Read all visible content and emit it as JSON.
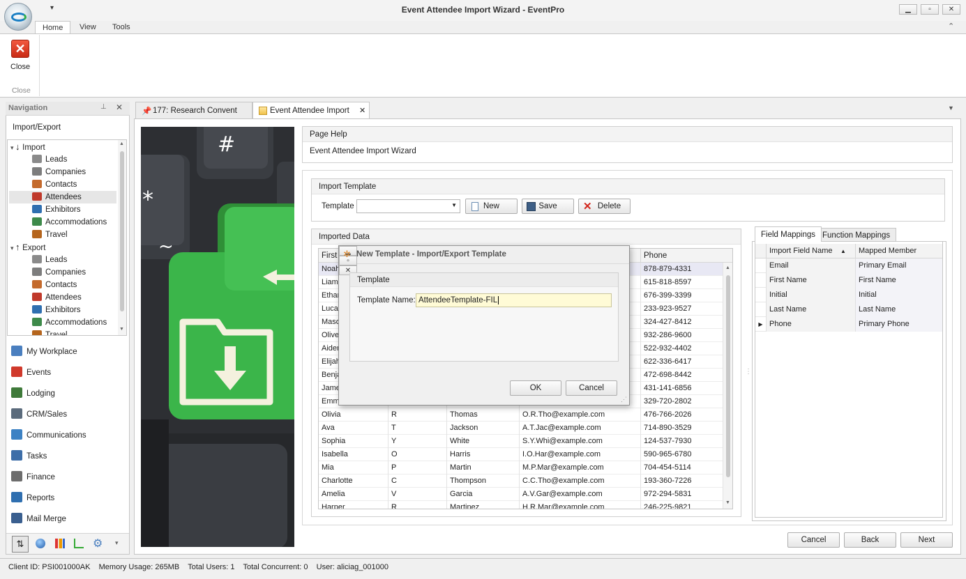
{
  "app": {
    "title": "Event Attendee Import Wizard - EventPro",
    "qat_arrow": "▾"
  },
  "window_buttons": {
    "minimize": "▁",
    "restore": "▫",
    "close": "✕"
  },
  "ribbon": {
    "tabs": [
      "Home",
      "View",
      "Tools"
    ],
    "active_tab": "Home",
    "close_button_label": "Close",
    "group_label": "Close",
    "collapse_glyph": "⌃"
  },
  "navigation": {
    "header": "Navigation",
    "section_title": "Import/Export",
    "tree": [
      {
        "label": "Import",
        "level": 0,
        "icon": "import-arrow-icon"
      },
      {
        "label": "Leads",
        "level": 1,
        "icon": "leads-icon"
      },
      {
        "label": "Companies",
        "level": 1,
        "icon": "companies-icon"
      },
      {
        "label": "Contacts",
        "level": 1,
        "icon": "contacts-icon"
      },
      {
        "label": "Attendees",
        "level": 1,
        "icon": "attendees-icon",
        "selected": true
      },
      {
        "label": "Exhibitors",
        "level": 1,
        "icon": "exhibitors-icon"
      },
      {
        "label": "Accommodations",
        "level": 1,
        "icon": "accommodations-icon"
      },
      {
        "label": "Travel",
        "level": 1,
        "icon": "travel-icon"
      },
      {
        "label": "Export",
        "level": 0,
        "icon": "export-arrow-icon"
      },
      {
        "label": "Leads",
        "level": 1,
        "icon": "leads-icon"
      },
      {
        "label": "Companies",
        "level": 1,
        "icon": "companies-icon"
      },
      {
        "label": "Contacts",
        "level": 1,
        "icon": "contacts-icon"
      },
      {
        "label": "Attendees",
        "level": 1,
        "icon": "attendees-icon"
      },
      {
        "label": "Exhibitors",
        "level": 1,
        "icon": "exhibitors-icon"
      },
      {
        "label": "Accommodations",
        "level": 1,
        "icon": "accommodations-icon"
      },
      {
        "label": "Travel",
        "level": 1,
        "icon": "travel-icon"
      }
    ],
    "items": [
      {
        "label": "My Workplace",
        "icon": "home-icon",
        "color": "#4a7fbf"
      },
      {
        "label": "Events",
        "icon": "pushpin-icon",
        "color": "#d0392b"
      },
      {
        "label": "Lodging",
        "icon": "lodging-icon",
        "color": "#3f7a3a"
      },
      {
        "label": "CRM/Sales",
        "icon": "crm-icon",
        "color": "#5b6b7c"
      },
      {
        "label": "Communications",
        "icon": "speech-bubble-icon",
        "color": "#3d82c4"
      },
      {
        "label": "Tasks",
        "icon": "tasks-icon",
        "color": "#3e6ea8"
      },
      {
        "label": "Finance",
        "icon": "finance-icon",
        "color": "#6d6d6d"
      },
      {
        "label": "Reports",
        "icon": "reports-icon",
        "color": "#2f6fb0"
      },
      {
        "label": "Mail Merge",
        "icon": "mail-merge-icon",
        "color": "#3a5f8f"
      }
    ]
  },
  "document_tabs": [
    {
      "label": "177: Research Convent",
      "icon": "pushpin-icon"
    },
    {
      "label": "Event Attendee Import",
      "icon": "wizard-icon",
      "active": true
    }
  ],
  "page_help": {
    "header": "Page Help",
    "text": "Event Attendee Import Wizard"
  },
  "import_template": {
    "header": "Import Template",
    "label": "Template",
    "value": "",
    "buttons": {
      "new": "New",
      "save": "Save",
      "delete": "Delete"
    }
  },
  "imported_data": {
    "header": "Imported Data",
    "columns": [
      "First",
      "",
      "",
      "",
      "Phone"
    ],
    "rows": [
      [
        "Noah",
        "",
        "",
        "",
        "878-879-4331"
      ],
      [
        "Liam",
        "",
        "",
        "",
        "615-818-8597"
      ],
      [
        "Ethan",
        "",
        "",
        "",
        "676-399-3399"
      ],
      [
        "Lucas",
        "",
        "",
        "",
        "233-923-9527"
      ],
      [
        "Mason",
        "",
        "",
        "",
        "324-427-8412"
      ],
      [
        "Oliver",
        "",
        "",
        "",
        "932-286-9600"
      ],
      [
        "Aiden",
        "",
        "",
        "",
        "522-932-4402"
      ],
      [
        "Elijah",
        "",
        "",
        "",
        "622-336-6417"
      ],
      [
        "Benjamin",
        "",
        "",
        "",
        "472-698-8442"
      ],
      [
        "James",
        "",
        "",
        "",
        "431-141-6856"
      ],
      [
        "Emma",
        "",
        "",
        "",
        "329-720-2802"
      ],
      [
        "Olivia",
        "R",
        "Thomas",
        "O.R.Tho@example.com",
        "476-766-2026"
      ],
      [
        "Ava",
        "T",
        "Jackson",
        "A.T.Jac@example.com",
        "714-890-3529"
      ],
      [
        "Sophia",
        "Y",
        "White",
        "S.Y.Whi@example.com",
        "124-537-7930"
      ],
      [
        "Isabella",
        "O",
        "Harris",
        "I.O.Har@example.com",
        "590-965-6780"
      ],
      [
        "Mia",
        "P",
        "Martin",
        "M.P.Mar@example.com",
        "704-454-5114"
      ],
      [
        "Charlotte",
        "C",
        "Thompson",
        "C.C.Tho@example.com",
        "193-360-7226"
      ],
      [
        "Amelia",
        "V",
        "Garcia",
        "A.V.Gar@example.com",
        "972-294-5831"
      ],
      [
        "Harper",
        "R",
        "Martinez",
        "H.R.Mar@example.com",
        "246-225-9821"
      ]
    ]
  },
  "mappings": {
    "tabs": [
      "Field Mappings",
      "Function Mappings"
    ],
    "columns": [
      "Import Field Name",
      "Mapped Member"
    ],
    "sort_glyph": "▲",
    "rows": [
      [
        "Email",
        "Primary Email"
      ],
      [
        "First Name",
        "First Name"
      ],
      [
        "Initial",
        "Initial"
      ],
      [
        "Last Name",
        "Last Name"
      ],
      [
        "Phone",
        "Primary Phone"
      ]
    ],
    "current_row": 4
  },
  "dialog": {
    "title": "New Template - Import/Export Template",
    "group": "Template",
    "field_label": "Template Name:",
    "field_value": "AttendeeTemplate-FIL",
    "ok": "OK",
    "cancel": "Cancel"
  },
  "wizard_buttons": {
    "cancel": "Cancel",
    "back": "Back",
    "next": "Next"
  },
  "status": {
    "client_id": "Client ID: PSI001000AK",
    "memory": "Memory Usage: 265MB",
    "total_users": "Total Users: 1",
    "total_concurrent": "Total Concurrent: 0",
    "user": "User: aliciag_001000"
  },
  "colors": {
    "accent": "#3d82c4",
    "key_green": "#3bb54a",
    "selected_row": "#e8e8f4",
    "input_highlight": "#fffbd6"
  }
}
